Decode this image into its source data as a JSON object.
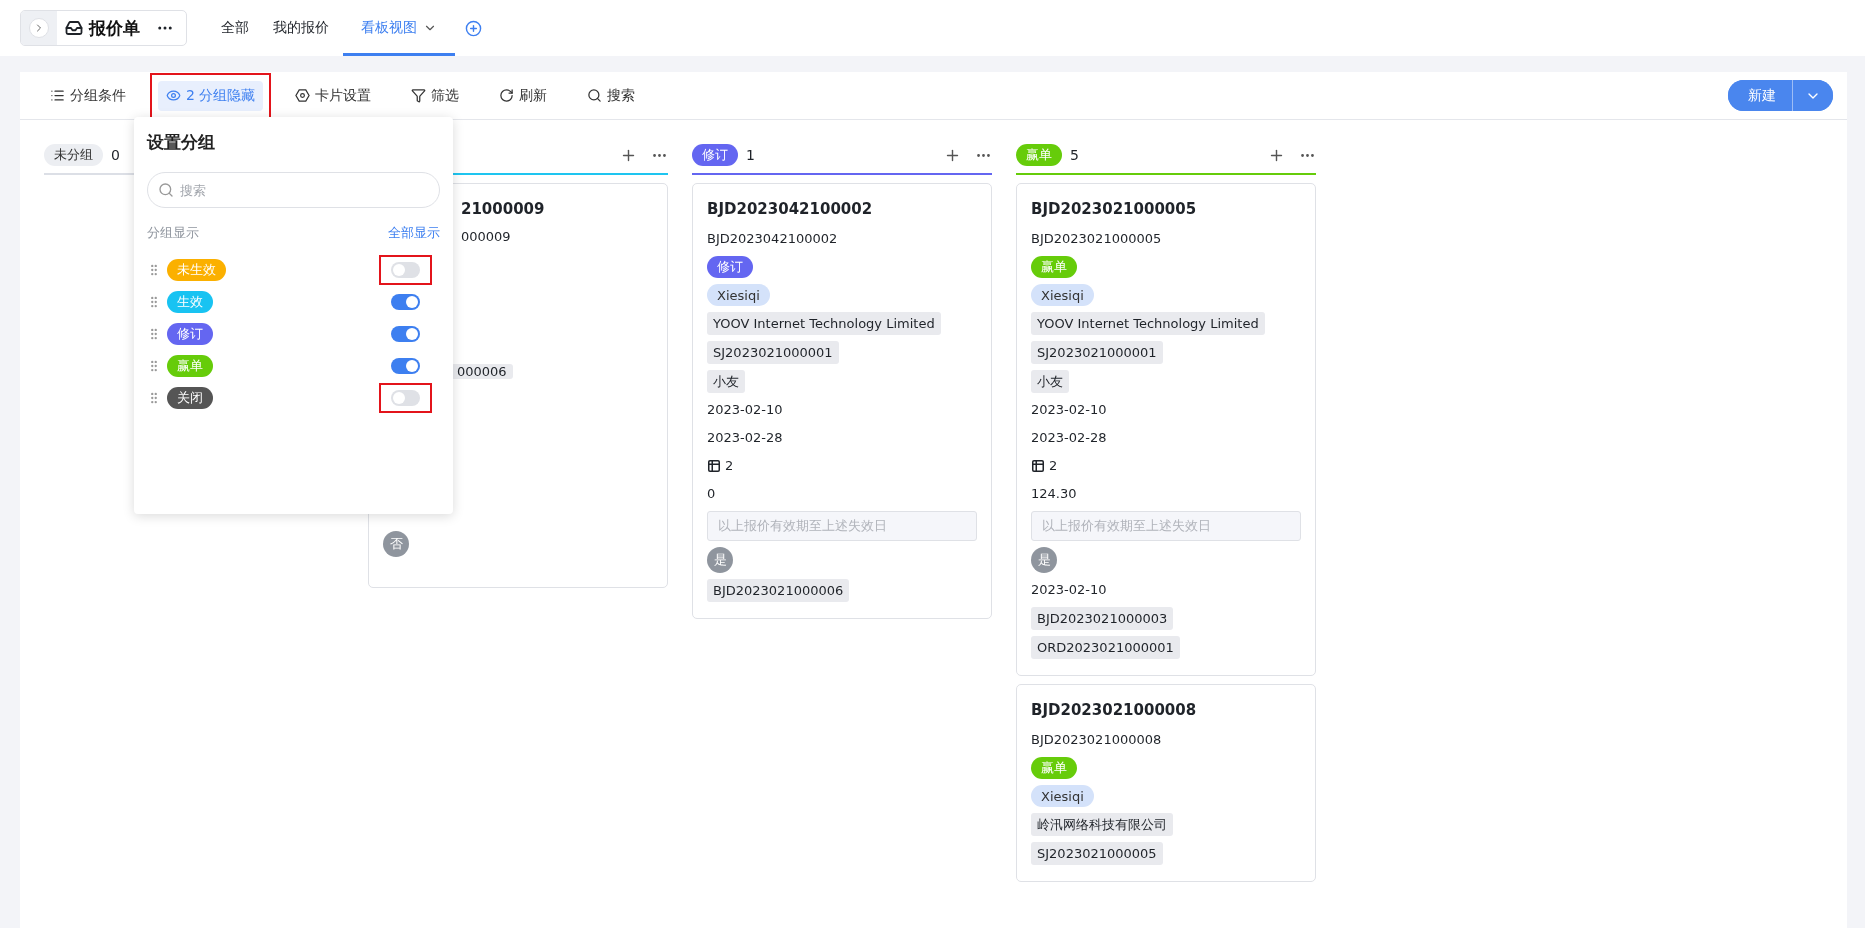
{
  "app": {
    "title": "报价单"
  },
  "tabs": [
    {
      "label": "全部",
      "selected": false,
      "has_menu": false
    },
    {
      "label": "我的报价",
      "selected": false,
      "has_menu": false
    },
    {
      "label": "看板视图",
      "selected": true,
      "has_menu": true
    }
  ],
  "toolbar": {
    "items": [
      {
        "kind": "group_by",
        "label": "分组条件",
        "selected": false,
        "highlighted": false
      },
      {
        "kind": "hidden_groups",
        "label": "2 分组隐藏",
        "selected": true,
        "highlighted": true
      },
      {
        "kind": "card_settings",
        "label": "卡片设置",
        "selected": false,
        "highlighted": false
      },
      {
        "kind": "filter",
        "label": "筛选",
        "selected": false,
        "highlighted": false
      },
      {
        "kind": "refresh",
        "label": "刷新",
        "selected": false,
        "highlighted": false
      },
      {
        "kind": "search",
        "label": "搜索",
        "selected": false,
        "highlighted": false
      }
    ],
    "new_button": "新建"
  },
  "columns": [
    {
      "kind": "plain",
      "label": "未分组",
      "count": "0",
      "color": "#dcdfe6"
    },
    {
      "color": "#1ec5f0",
      "actions": true,
      "cards": [
        {
          "covered": true,
          "fields": [
            {
              "kind": "title",
              "text": "21000009"
            },
            {
              "kind": "text",
              "text": "000009"
            },
            {
              "kind": "tag",
              "text": "000006"
            },
            {
              "kind": "flag",
              "text": "否"
            }
          ]
        }
      ]
    },
    {
      "kind": "status",
      "label": "修订",
      "count": "1",
      "color": "#6466f1",
      "actions": true,
      "cards": [
        {
          "covered": false,
          "fields": [
            {
              "kind": "title",
              "text": "BJD2023042100002"
            },
            {
              "kind": "text",
              "text": "BJD2023042100002"
            },
            {
              "kind": "status",
              "text": "修订",
              "color": "#6466f1"
            },
            {
              "kind": "person",
              "text": "Xiesiqi"
            },
            {
              "kind": "tag",
              "text": "YOOV Internet Technology Limited"
            },
            {
              "kind": "tag",
              "text": "SJ2023021000001"
            },
            {
              "kind": "tag",
              "text": "小友"
            },
            {
              "kind": "text",
              "text": "2023-02-10"
            },
            {
              "kind": "text",
              "text": "2023-02-28"
            },
            {
              "kind": "count",
              "text": "2"
            },
            {
              "kind": "text",
              "text": "0"
            },
            {
              "kind": "note",
              "text": "以上报价有效期至上述失效日"
            },
            {
              "kind": "flag",
              "text": "是"
            },
            {
              "kind": "tag",
              "text": "BJD2023021000006"
            }
          ]
        }
      ]
    },
    {
      "kind": "status",
      "label": "赢单",
      "count": "5",
      "color": "#66cc0a",
      "actions": true,
      "cards": [
        {
          "covered": false,
          "fields": [
            {
              "kind": "title",
              "text": "BJD2023021000005"
            },
            {
              "kind": "text",
              "text": "BJD2023021000005"
            },
            {
              "kind": "status",
              "text": "赢单",
              "color": "#66cc0a"
            },
            {
              "kind": "person",
              "text": "Xiesiqi"
            },
            {
              "kind": "tag",
              "text": "YOOV Internet Technology Limited"
            },
            {
              "kind": "tag",
              "text": "SJ2023021000001"
            },
            {
              "kind": "tag",
              "text": "小友"
            },
            {
              "kind": "text",
              "text": "2023-02-10"
            },
            {
              "kind": "text",
              "text": "2023-02-28"
            },
            {
              "kind": "count",
              "text": "2"
            },
            {
              "kind": "text",
              "text": "124.30"
            },
            {
              "kind": "note",
              "text": "以上报价有效期至上述失效日"
            },
            {
              "kind": "flag",
              "text": "是"
            },
            {
              "kind": "text",
              "text": "2023-02-10"
            },
            {
              "kind": "tag",
              "text": "BJD2023021000003"
            },
            {
              "kind": "tag",
              "text": "ORD2023021000001"
            }
          ]
        },
        {
          "covered": false,
          "fields": [
            {
              "kind": "title",
              "text": "BJD2023021000008"
            },
            {
              "kind": "text",
              "text": "BJD2023021000008"
            },
            {
              "kind": "status",
              "text": "赢单",
              "color": "#66cc0a"
            },
            {
              "kind": "person",
              "text": "Xiesiqi"
            },
            {
              "kind": "tag",
              "text": "岭汛网络科技有限公司"
            },
            {
              "kind": "tag",
              "text": "SJ2023021000005"
            }
          ]
        }
      ]
    }
  ],
  "settings_popup": {
    "title": "设置分组",
    "search_placeholder": "搜索",
    "section_label": "分组显示",
    "show_all": "全部显示",
    "groups": [
      {
        "label": "未生效",
        "color": "#fbb000",
        "visible": false,
        "highlighted": true
      },
      {
        "label": "生效",
        "color": "#18c3f2",
        "visible": true,
        "highlighted": false
      },
      {
        "label": "修订",
        "color": "#6466f1",
        "visible": true,
        "highlighted": false
      },
      {
        "label": "赢单",
        "color": "#66cc0a",
        "visible": true,
        "highlighted": false
      },
      {
        "label": "关闭",
        "color": "#555555",
        "visible": false,
        "highlighted": true
      }
    ]
  }
}
